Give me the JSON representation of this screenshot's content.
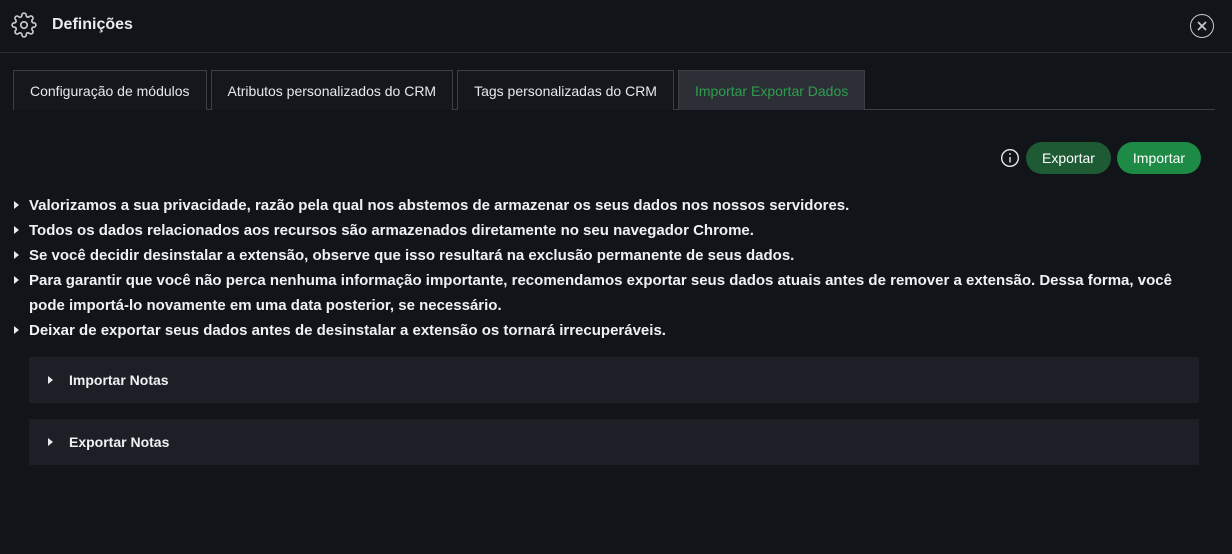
{
  "header": {
    "icon": "gear-icon",
    "title": "Definições",
    "close_icon": "close-icon"
  },
  "tabs": [
    {
      "label": "Configuração de módulos",
      "active": false
    },
    {
      "label": "Atributos personalizados do CRM",
      "active": false
    },
    {
      "label": "Tags personalizadas do CRM",
      "active": false
    },
    {
      "label": "Importar Exportar Dados",
      "active": true
    }
  ],
  "actions": {
    "info_icon": "info-icon",
    "export_label": "Exportar",
    "import_label": "Importar"
  },
  "notices": [
    "Valorizamos a sua privacidade, razão pela qual nos abstemos de armazenar os seus dados nos nossos servidores.",
    "Todos os dados relacionados aos recursos são armazenados diretamente no seu navegador Chrome.",
    "Se você decidir desinstalar a extensão, observe que isso resultará na exclusão permanente de seus dados.",
    "Para garantir que você não perca nenhuma informação importante, recomendamos exportar seus dados atuais antes de remover a extensão. Dessa forma, você pode importá-lo novamente em uma data posterior, se necessário.",
    "Deixar de exportar seus dados antes de desinstalar a extensão os tornará irrecuperáveis."
  ],
  "accordions": [
    {
      "label": "Importar Notas",
      "expanded": false
    },
    {
      "label": "Exportar Notas",
      "expanded": false
    }
  ],
  "colors": {
    "background": "#111418",
    "accent_green": "#2e9d4f",
    "export_button": "#1e5a33",
    "import_button": "#1d8a46",
    "accordion_bg": "#1c2026"
  }
}
